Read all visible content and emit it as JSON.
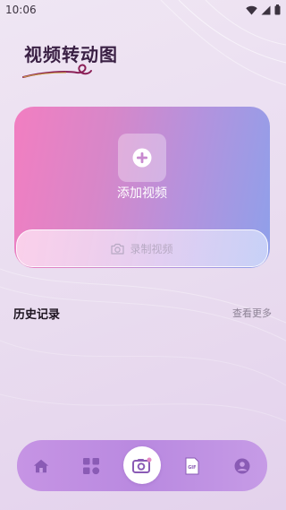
{
  "status_bar": {
    "time": "10:06"
  },
  "app": {
    "title": "视频转动图"
  },
  "main_card": {
    "add_label": "添加视频",
    "record_label": "录制视频"
  },
  "history": {
    "title": "历史记录",
    "more_label": "查看更多"
  },
  "bottom_nav": {
    "items": [
      {
        "icon": "home-icon"
      },
      {
        "icon": "apps-icon"
      },
      {
        "icon": "camera-icon"
      },
      {
        "icon": "gif-file-icon",
        "badge": "GIF"
      },
      {
        "icon": "profile-icon"
      }
    ]
  },
  "colors": {
    "card_start": "#f27ec1",
    "card_end": "#8fa0ea",
    "nav_bg": "#bd8de2",
    "title": "#3a2044"
  }
}
